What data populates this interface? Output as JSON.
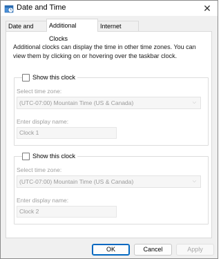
{
  "window": {
    "title": "Date and Time",
    "close_glyph": "✕"
  },
  "tabs": [
    {
      "label": "Date and Time",
      "active": false
    },
    {
      "label": "Additional Clocks",
      "active": true
    },
    {
      "label": "Internet Time",
      "active": false
    }
  ],
  "intro_text": "Additional clocks can display the time in other time zones. You can view them by clicking on or hovering over the taskbar clock.",
  "clocks": [
    {
      "show_label": "Show this clock",
      "checked": false,
      "timezone_label": "Select time zone:",
      "timezone_value": "(UTC-07:00) Mountain Time (US & Canada)",
      "display_label": "Enter display name:",
      "display_value": "Clock 1"
    },
    {
      "show_label": "Show this clock",
      "checked": false,
      "timezone_label": "Select time zone:",
      "timezone_value": "(UTC-07:00) Mountain Time (US & Canada)",
      "display_label": "Enter display name:",
      "display_value": "Clock 2"
    }
  ],
  "buttons": {
    "ok": "OK",
    "cancel": "Cancel",
    "apply": "Apply"
  },
  "icons": {
    "title": "clock-icon",
    "dropdown": "chevron-down-icon",
    "close": "close-icon"
  },
  "colors": {
    "accent": "#0067c0",
    "disabled_text": "#a0a0a0"
  }
}
